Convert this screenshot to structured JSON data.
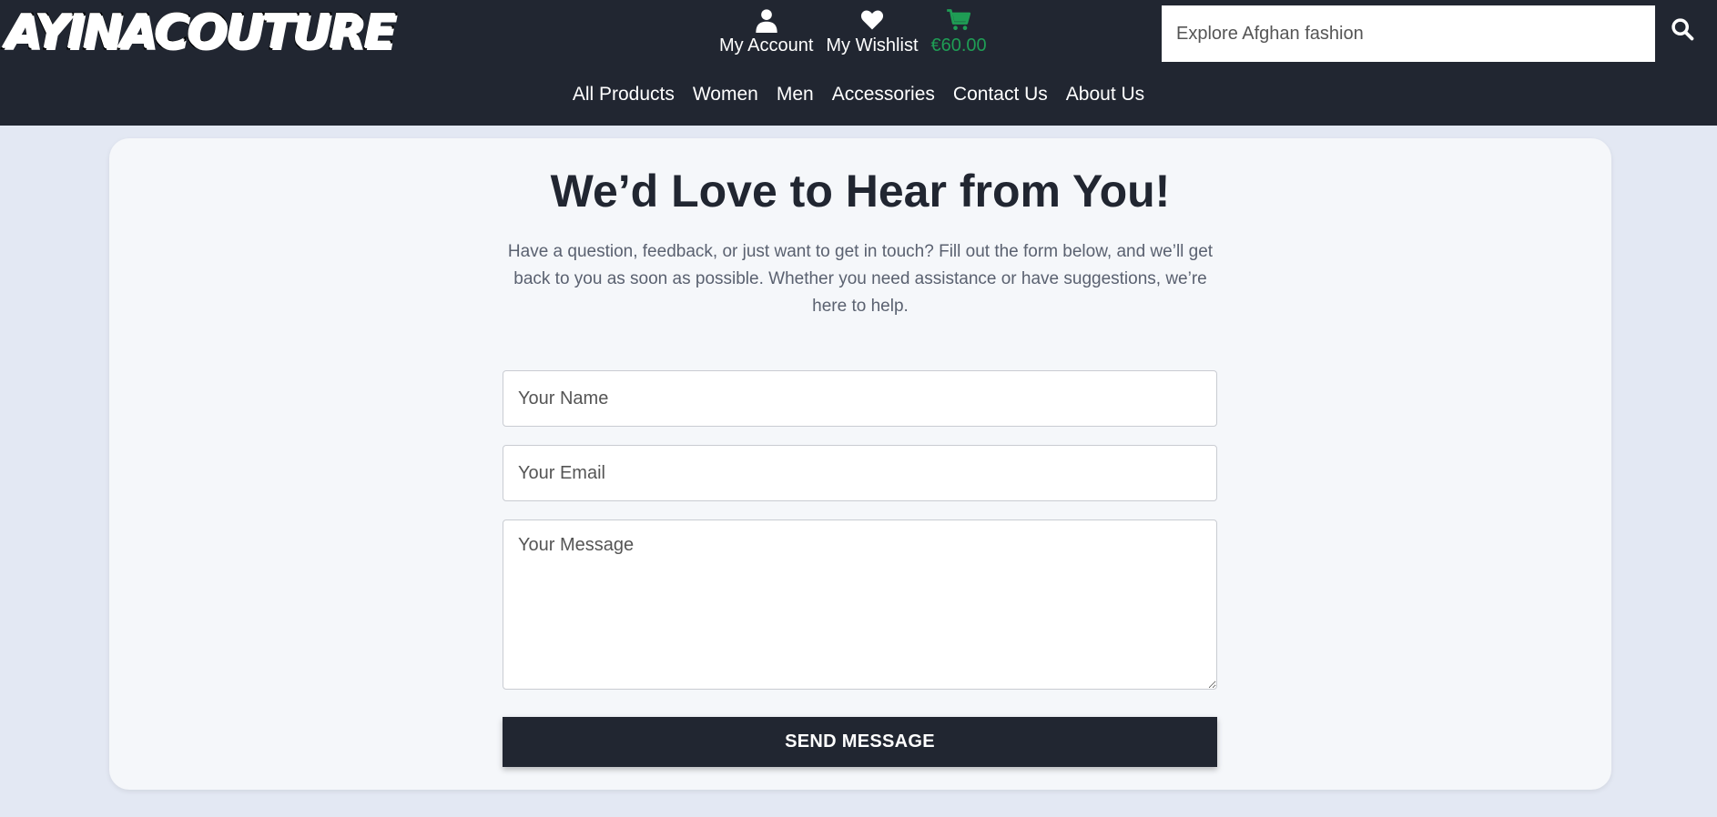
{
  "brand": {
    "logo_text": "AYINACOUTURE"
  },
  "header": {
    "account": {
      "label": "My Account",
      "icon": "user-icon"
    },
    "wishlist": {
      "label": "My Wishlist",
      "icon": "heart-icon"
    },
    "cart": {
      "label": "€60.00",
      "icon": "cart-icon",
      "color": "#1f9d55"
    },
    "search": {
      "placeholder": "Explore Afghan fashion",
      "icon": "search-icon"
    }
  },
  "nav": {
    "items": [
      {
        "label": "All Products"
      },
      {
        "label": "Women"
      },
      {
        "label": "Men"
      },
      {
        "label": "Accessories"
      },
      {
        "label": "Contact Us"
      },
      {
        "label": "About Us"
      }
    ]
  },
  "contact": {
    "title": "We’d Love to Hear from You!",
    "intro": "Have a question, feedback, or just want to get in touch? Fill out the form below, and we’ll get back to you as soon as possible. Whether you need assistance or have suggestions, we’re here to help.",
    "name_placeholder": "Your Name",
    "email_placeholder": "Your Email",
    "message_placeholder": "Your Message",
    "submit_label": "SEND MESSAGE"
  },
  "colors": {
    "header_bg": "#212631",
    "page_bg": "#e3e8f3",
    "card_bg": "#f5f7fa",
    "accent_green": "#1f9d55"
  }
}
